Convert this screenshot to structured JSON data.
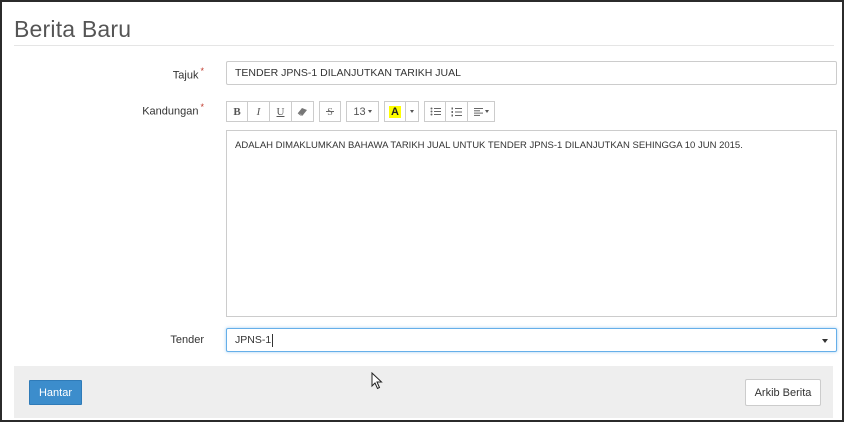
{
  "page": {
    "title": "Berita Baru"
  },
  "form": {
    "tajuk": {
      "label": "Tajuk",
      "required_mark": "*",
      "value": "TENDER JPNS-1 DILANJUTKAN TARIKH JUAL"
    },
    "kandungan": {
      "label": "Kandungan",
      "required_mark": "*",
      "value": "ADALAH DIMAKLUMKAN BAHAWA TARIKH JUAL UNTUK TENDER JPNS-1 DILANJUTKAN SEHINGGA 10 JUN 2015.",
      "toolbar": {
        "bold": "B",
        "italic": "I",
        "underline": "U",
        "font_size": "13",
        "font_color_letter": "A",
        "font_color_highlight": "#ffff00"
      }
    },
    "tender": {
      "label": "Tender",
      "value": "JPNS-1"
    }
  },
  "actions": {
    "submit_label": "Hantar",
    "archive_label": "Arkib Berita"
  },
  "colors": {
    "primary": "#3c8dcc",
    "focus_border": "#66afe9",
    "required": "#c0392b"
  }
}
